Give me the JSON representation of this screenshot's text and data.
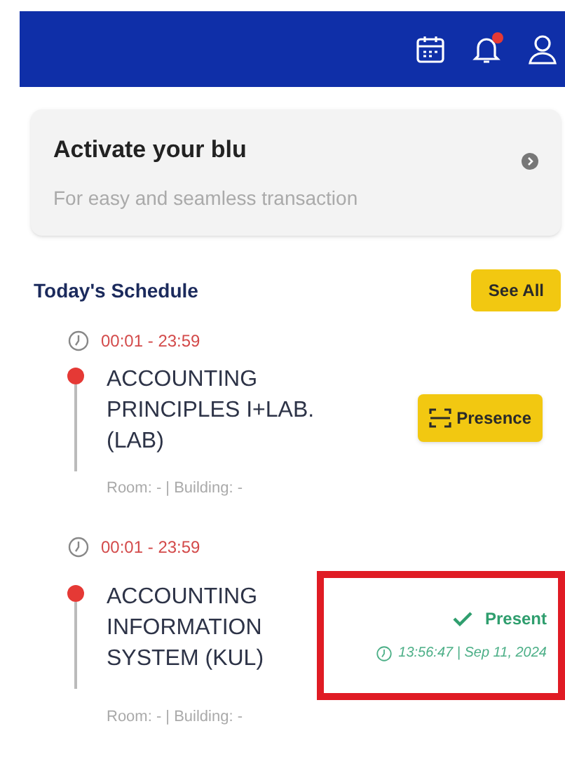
{
  "header": {
    "notification_badge": true
  },
  "promo": {
    "title": "Activate your blu",
    "subtitle": "For easy and seamless transaction"
  },
  "schedule": {
    "title": "Today's Schedule",
    "see_all": "See All",
    "items": [
      {
        "time": "00:01 - 23:59",
        "course": "ACCOUNTING PRINCIPLES I+LAB. (LAB)",
        "location": "Room: - | Building: -",
        "kind": "action",
        "button": "Presence",
        "highlighted": false
      },
      {
        "time": "00:01 - 23:59",
        "course": "ACCOUNTING INFORMATION SYSTEM (KUL)",
        "location": "Room: - | Building: -",
        "kind": "status",
        "status": "Present",
        "timestamp": "13:56:47 | Sep 11, 2024",
        "highlighted": true
      }
    ]
  }
}
